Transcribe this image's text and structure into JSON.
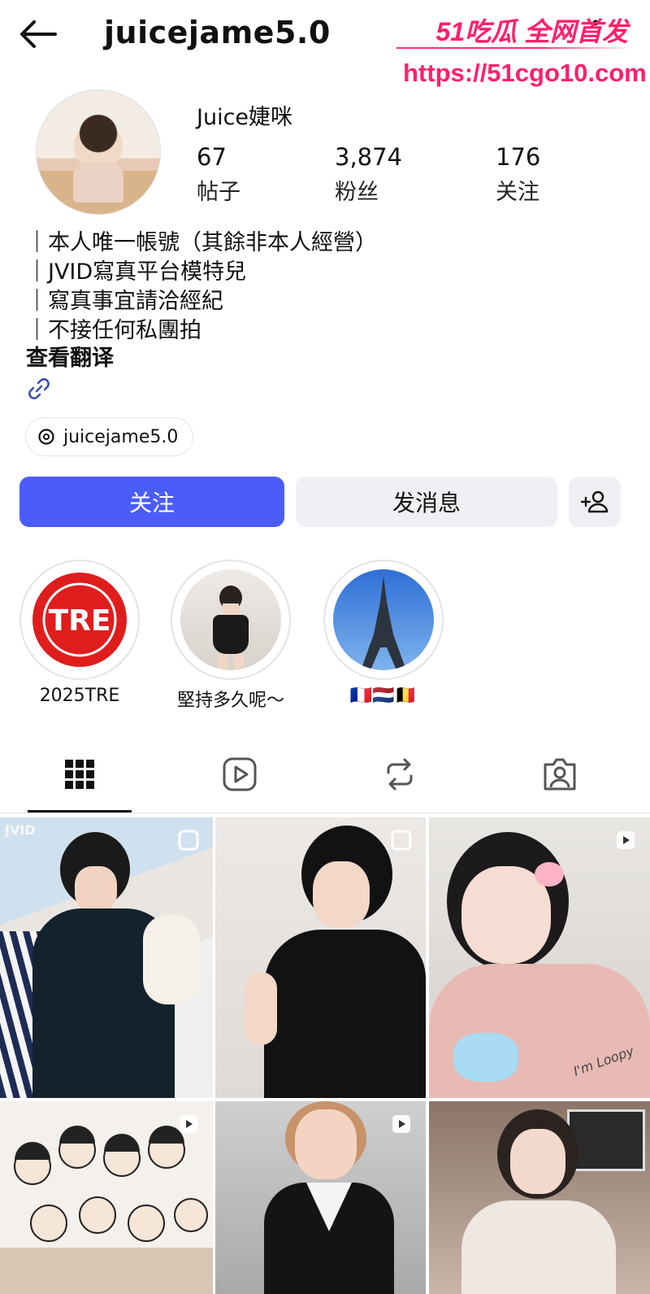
{
  "header": {
    "username": "juicejame5.0"
  },
  "watermark": {
    "line1": "51吃瓜 全网首发",
    "line2": "https://51cgo10.com"
  },
  "profile": {
    "display_name": "Juice婕咪",
    "stats": [
      {
        "value": "67",
        "label": "帖子"
      },
      {
        "value": "3,874",
        "label": "粉丝"
      },
      {
        "value": "176",
        "label": "关注"
      }
    ],
    "bio": [
      "｜本人唯一帳號（其餘非本人經營）",
      "｜JVID寫真平台模特兒",
      "｜寫真事宜請洽經紀",
      "｜不接任何私團拍"
    ],
    "translate": "查看翻译",
    "threads_handle": "juicejame5.0"
  },
  "actions": {
    "follow": "关注",
    "message": "发消息"
  },
  "highlights": [
    {
      "label": "2025TRE",
      "logo_text": "TRE"
    },
    {
      "label": "堅持多久呢～"
    },
    {
      "label": "🇫🇷🇳🇱🇧🇪"
    }
  ],
  "grid": {
    "jvid_tag": "JVID",
    "sticker_text": "I'm Loopy"
  },
  "colors": {
    "accent": "#4a5df9",
    "watermark": "#ff1f6b"
  }
}
